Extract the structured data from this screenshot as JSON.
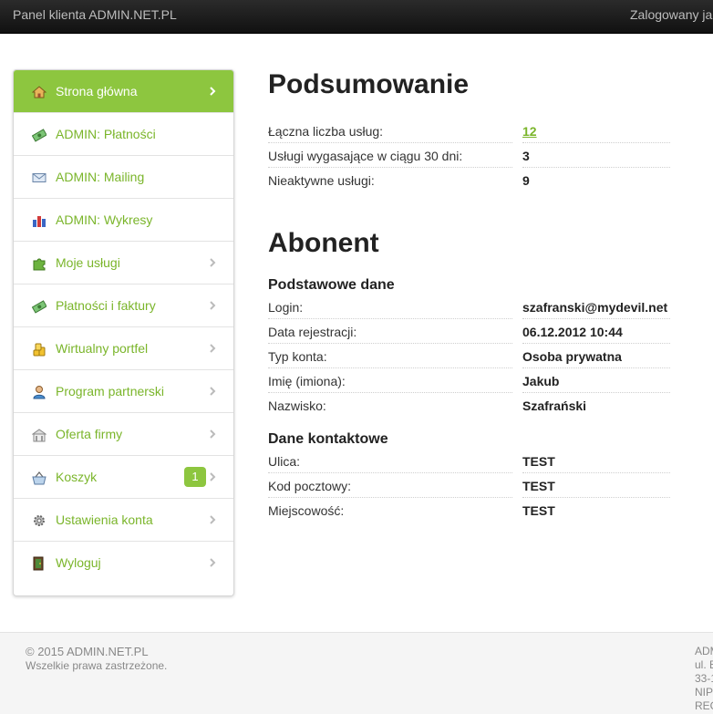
{
  "topbar": {
    "brand": "Panel klienta ADMIN.NET.PL",
    "user_text": "Zalogowany ja"
  },
  "sidebar": {
    "items": [
      {
        "label": "Strona główna",
        "icon": "home-icon",
        "active": true
      },
      {
        "label": "ADMIN: Płatności",
        "icon": "money-icon"
      },
      {
        "label": "ADMIN: Mailing",
        "icon": "envelope-icon"
      },
      {
        "label": "ADMIN: Wykresy",
        "icon": "bar-chart-icon"
      },
      {
        "label": "Moje usługi",
        "icon": "puzzle-icon"
      },
      {
        "label": "Płatności i faktury",
        "icon": "money-icon"
      },
      {
        "label": "Wirtualny portfel",
        "icon": "coins-icon"
      },
      {
        "label": "Program partnerski",
        "icon": "user-icon"
      },
      {
        "label": "Oferta firmy",
        "icon": "building-icon"
      },
      {
        "label": "Koszyk",
        "icon": "basket-icon",
        "badge": "1"
      },
      {
        "label": "Ustawienia konta",
        "icon": "gear-icon"
      },
      {
        "label": "Wyloguj",
        "icon": "logout-door-icon"
      }
    ]
  },
  "summary": {
    "title": "Podsumowanie",
    "rows": [
      {
        "key": "Łączna liczba usług:",
        "value": "12",
        "link": true
      },
      {
        "key": "Usługi wygasające w ciągu 30 dni:",
        "value": "3"
      },
      {
        "key": "Nieaktywne usługi:",
        "value": "9"
      }
    ]
  },
  "subscriber": {
    "title": "Abonent",
    "basic_title": "Podstawowe dane",
    "basic": [
      {
        "key": "Login:",
        "value": "szafranski@mydevil.net"
      },
      {
        "key": "Data rejestracji:",
        "value": "06.12.2012 10:44"
      },
      {
        "key": "Typ konta:",
        "value": "Osoba prywatna"
      },
      {
        "key": "Imię (imiona):",
        "value": "Jakub"
      },
      {
        "key": "Nazwisko:",
        "value": "Szafrański"
      }
    ],
    "contact_title": "Dane kontaktowe",
    "contact": [
      {
        "key": "Ulica:",
        "value": "TEST"
      },
      {
        "key": "Kod pocztowy:",
        "value": "TEST"
      },
      {
        "key": "Miejscowość:",
        "value": "TEST"
      }
    ]
  },
  "footer": {
    "copyright": "© 2015 ADMIN.NET.PL",
    "rights": "Wszelkie prawa zastrzeżone.",
    "address_lines": [
      "ADM",
      "ul. E",
      "33-1",
      "NIP",
      "REG"
    ]
  },
  "colors": {
    "accent": "#8dc63f",
    "link": "#7ab52a",
    "topbar": "#1a1a1a"
  }
}
